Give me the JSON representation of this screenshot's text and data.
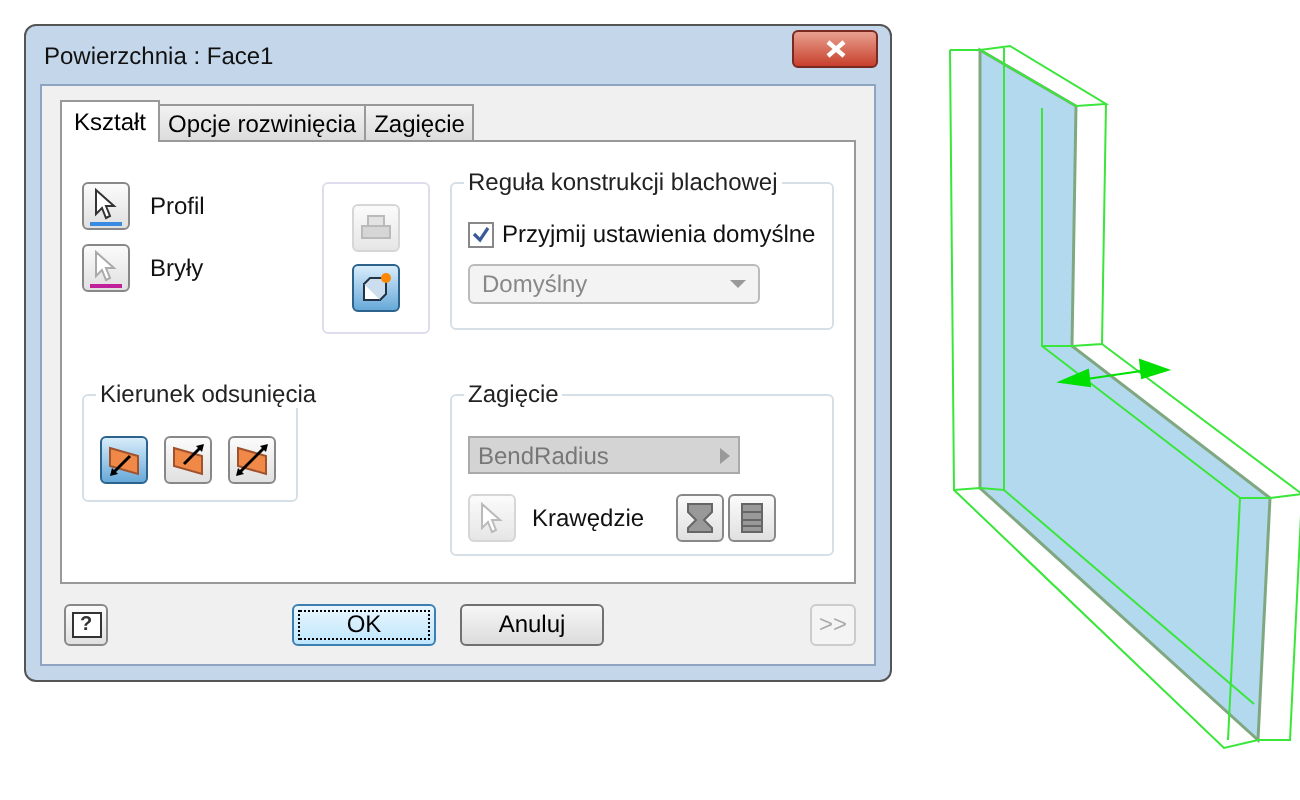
{
  "window": {
    "title": "Powierzchnia : Face1"
  },
  "tabs": [
    {
      "label": "Kształt",
      "selected": true
    },
    {
      "label": "Opcje rozwinięcia",
      "selected": false
    },
    {
      "label": "Zagięcie",
      "selected": false
    }
  ],
  "selectors": [
    {
      "label": "Profil",
      "kind": "profile"
    },
    {
      "label": "Bryły",
      "kind": "solid"
    }
  ],
  "tool_buttons": [
    {
      "kind": "print",
      "selected": false,
      "disabled": true
    },
    {
      "kind": "new",
      "selected": true,
      "disabled": false
    }
  ],
  "sheet_metal_rule": {
    "title": "Reguła konstrukcji blachowej",
    "checkbox": {
      "label": "Przyjmij ustawienia domyślne",
      "checked": true
    },
    "dropdown": {
      "value": "Domyślny",
      "disabled": true
    }
  },
  "offset_direction": {
    "title": "Kierunek odsunięcia",
    "buttons": [
      {
        "kind": "side1",
        "selected": true
      },
      {
        "kind": "side2",
        "selected": false
      },
      {
        "kind": "both",
        "selected": false
      }
    ]
  },
  "bend": {
    "title": "Zagięcie",
    "field": {
      "value": "BendRadius",
      "disabled": true
    },
    "edges_label": "Krawędzie"
  },
  "footer": {
    "help": "?",
    "ok": "OK",
    "cancel": "Anuluj",
    "more": ">>",
    "more_disabled": true
  }
}
